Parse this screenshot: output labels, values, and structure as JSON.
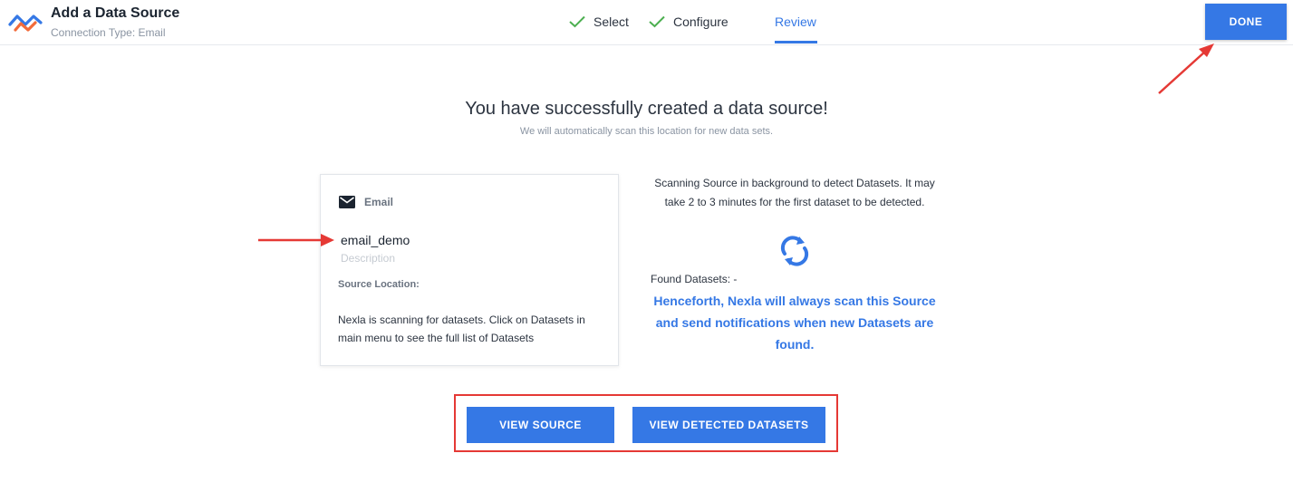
{
  "header": {
    "title": "Add a Data Source",
    "subtitle": "Connection Type: Email",
    "steps": [
      {
        "label": "Select",
        "state": "complete"
      },
      {
        "label": "Configure",
        "state": "complete"
      },
      {
        "label": "Review",
        "state": "active"
      }
    ],
    "done_label": "DONE"
  },
  "main": {
    "headline": "You have successfully created a data source!",
    "subline": "We will automatically scan this location for new data sets."
  },
  "card": {
    "type_icon": "mail-icon",
    "type_label": "Email",
    "name": "email_demo",
    "description_placeholder": "Description",
    "location_label": "Source Location:",
    "scan_message": "Nexla is scanning for datasets. Click on Datasets in main menu to see the full list of Datasets"
  },
  "status": {
    "scan_text": "Scanning Source in background to detect Datasets. It may take 2 to 3 minutes for the first dataset to be detected.",
    "refresh_icon": "refresh-icon",
    "found_datasets": "Found Datasets: -",
    "notice": "Henceforth, Nexla will always scan this Source and send notifications when new Datasets are found."
  },
  "actions": {
    "view_source": "VIEW SOURCE",
    "view_datasets": "VIEW DETECTED DATASETS"
  },
  "colors": {
    "accent": "#3578e5",
    "annotation": "#e53935",
    "check": "#4caf50"
  }
}
